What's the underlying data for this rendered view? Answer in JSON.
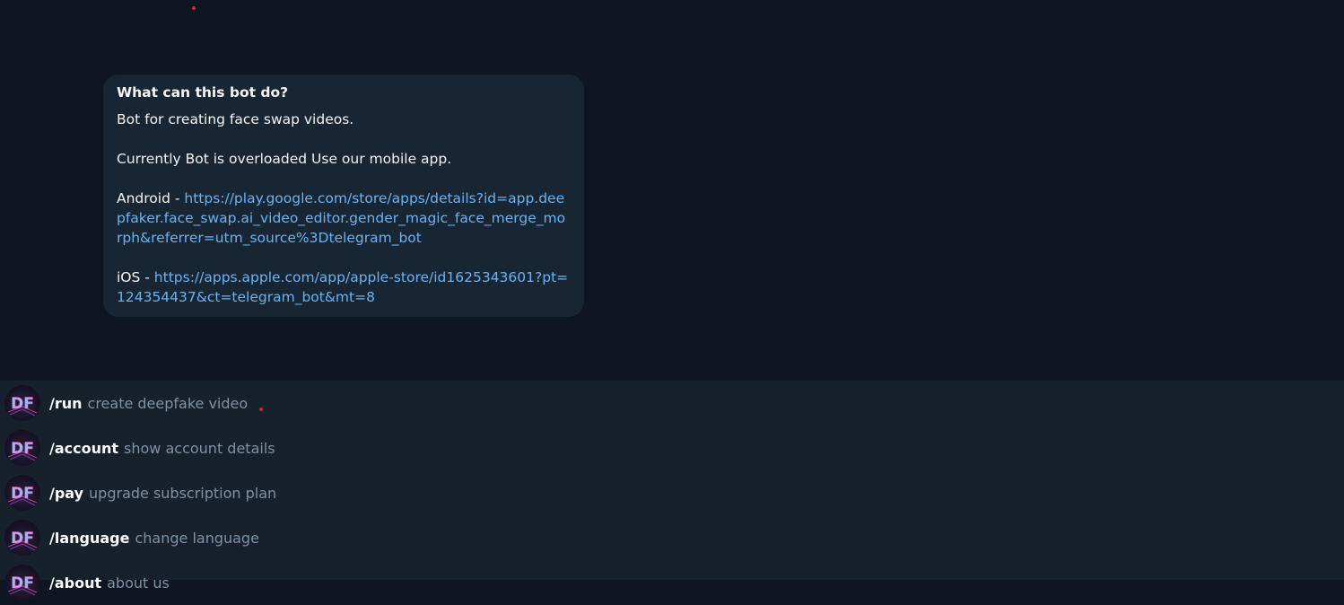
{
  "bot_info": {
    "title": "What can this bot do?",
    "line1": "Bot for creating face swap videos.",
    "line2": "Currently Bot is overloaded Use our mobile app.",
    "android_prefix": "Android - ",
    "android_link": "https://play.google.com/store/apps/details?id=app.deepfaker.face_swap.ai_video_editor.gender_magic_face_merge_morph&referrer=utm_source%3Dtelegram_bot",
    "ios_prefix": "iOS - ",
    "ios_link": "https://apps.apple.com/app/apple-store/id1625343601?pt=124354437&ct=telegram_bot&mt=8"
  },
  "commands": [
    {
      "name": "/run",
      "desc": "create deepfake video"
    },
    {
      "name": "/account",
      "desc": "show account details"
    },
    {
      "name": "/pay",
      "desc": "upgrade subscription plan"
    },
    {
      "name": "/language",
      "desc": "change language"
    },
    {
      "name": "/about",
      "desc": "about us"
    }
  ],
  "avatar_text": "DF",
  "colors": {
    "chat_bg": "#0e1621",
    "bubble_bg": "#182533",
    "panel_bg": "#17212b",
    "link": "#6ab3f3",
    "desc": "#7f91a4"
  }
}
